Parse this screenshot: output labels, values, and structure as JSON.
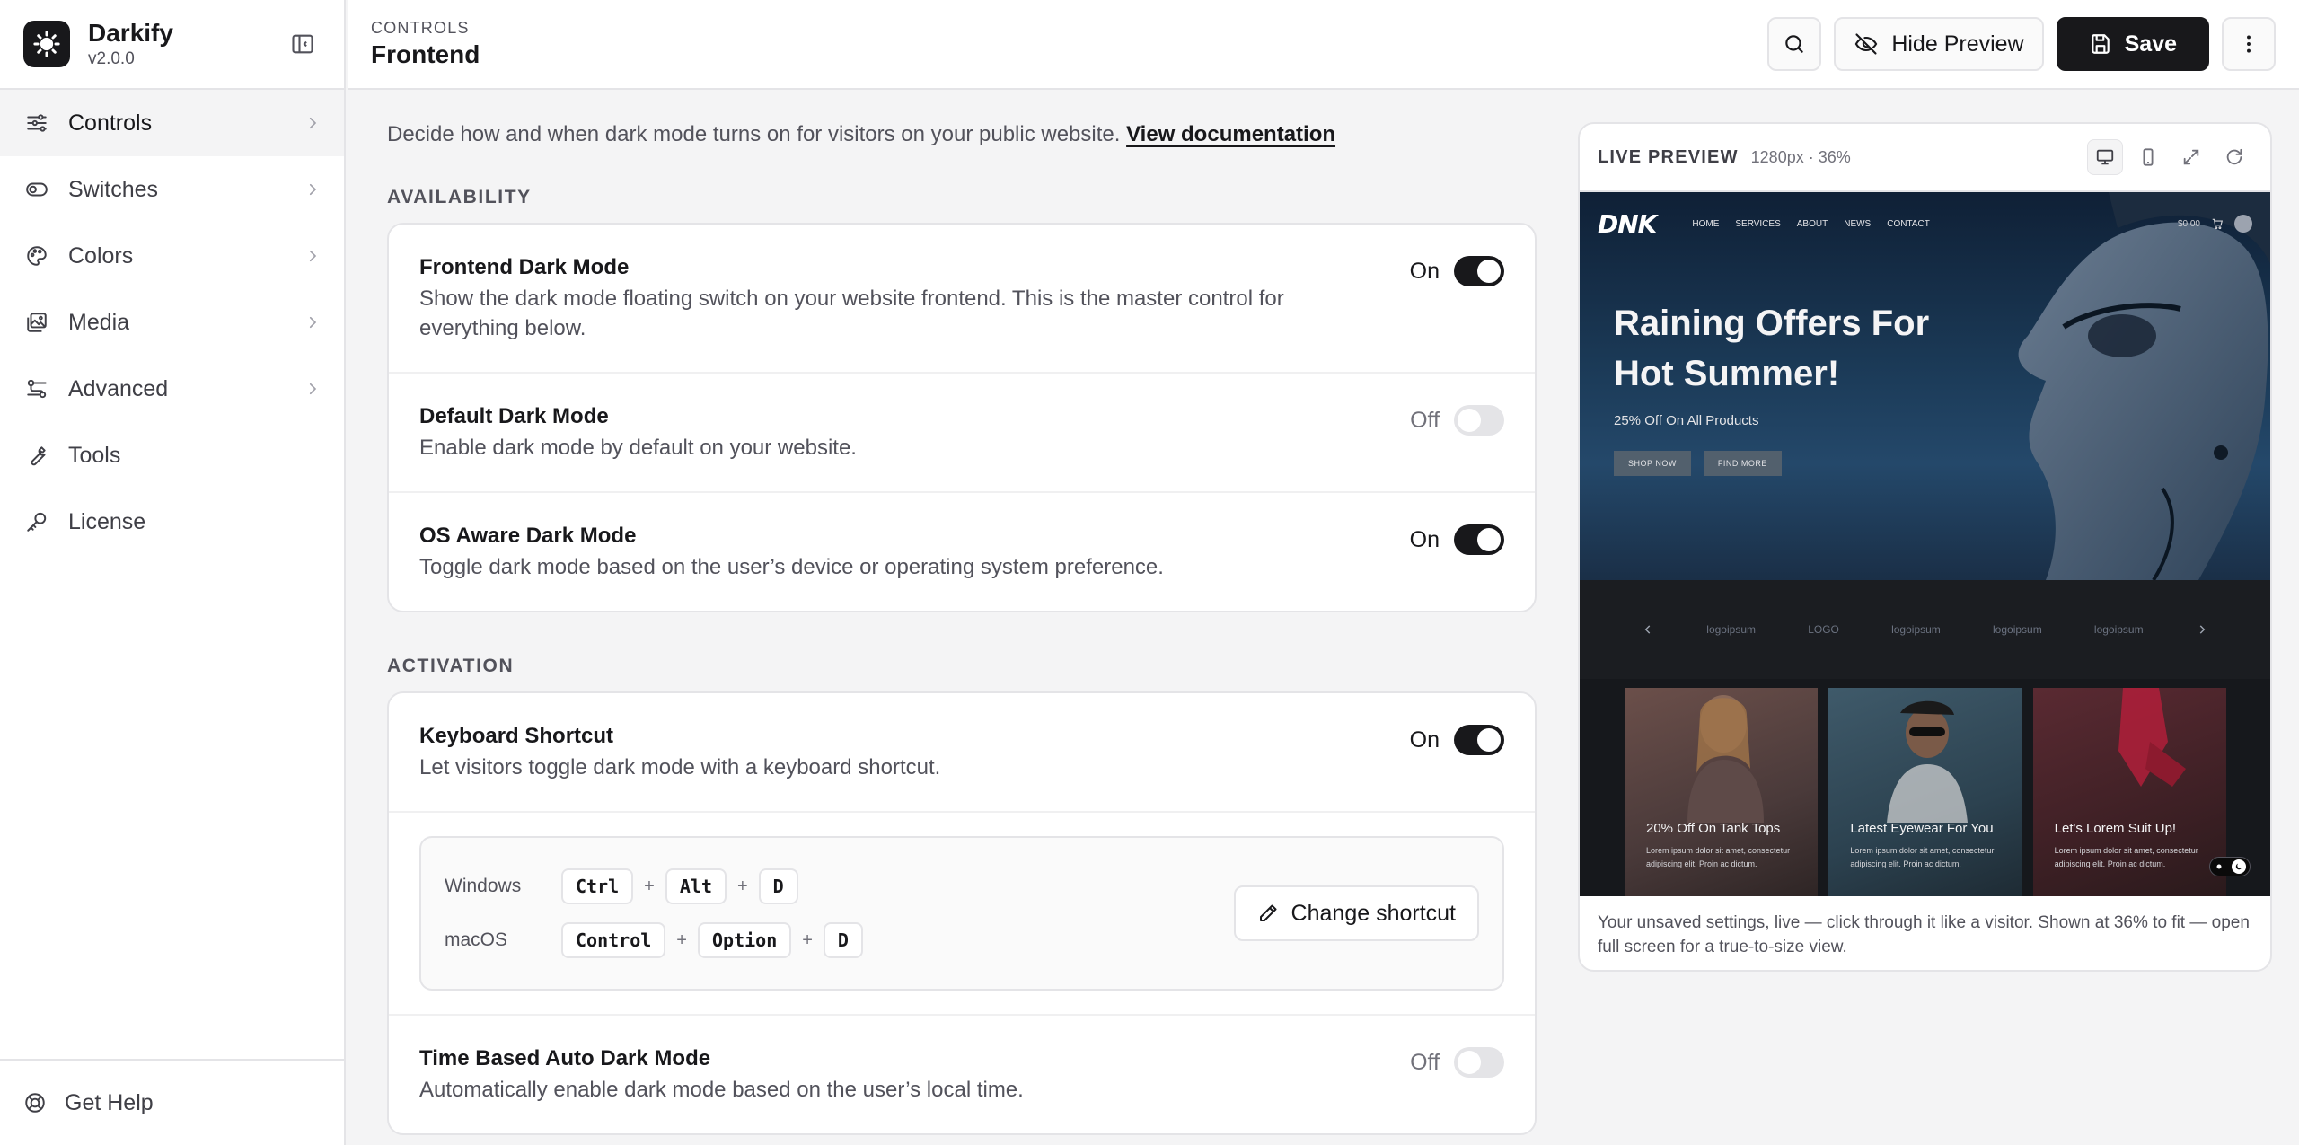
{
  "app": {
    "name": "Darkify",
    "version": "v2.0.0"
  },
  "sidebar": {
    "items": [
      {
        "label": "Controls",
        "icon": "sliders-icon"
      },
      {
        "label": "Switches",
        "icon": "toggle-icon"
      },
      {
        "label": "Colors",
        "icon": "palette-icon"
      },
      {
        "label": "Media",
        "icon": "image-icon"
      },
      {
        "label": "Advanced",
        "icon": "settings-sliders-icon"
      },
      {
        "label": "Tools",
        "icon": "wrench-icon"
      },
      {
        "label": "License",
        "icon": "key-icon"
      }
    ],
    "footer_label": "Get Help"
  },
  "header": {
    "breadcrumb": "CONTROLS",
    "title": "Frontend",
    "hide_preview_label": "Hide Preview",
    "save_label": "Save"
  },
  "intro": {
    "text": "Decide how and when dark mode turns on for visitors on your public website.",
    "link": "View documentation"
  },
  "availability": {
    "label": "AVAILABILITY",
    "rows": [
      {
        "title": "Frontend Dark Mode",
        "desc": "Show the dark mode floating switch on your website frontend. This is the master control for everything below.",
        "state": "On"
      },
      {
        "title": "Default Dark Mode",
        "desc": "Enable dark mode by default on your website.",
        "state": "Off"
      },
      {
        "title": "OS Aware Dark Mode",
        "desc": "Toggle dark mode based on the user’s device or operating system preference.",
        "state": "On"
      }
    ]
  },
  "activation": {
    "label": "ACTIVATION",
    "keyboard": {
      "title": "Keyboard Shortcut",
      "desc": "Let visitors toggle dark mode with a keyboard shortcut.",
      "state": "On"
    },
    "shortcuts": {
      "windows_label": "Windows",
      "windows_keys": [
        "Ctrl",
        "Alt",
        "D"
      ],
      "mac_label": "macOS",
      "mac_keys": [
        "Control",
        "Option",
        "D"
      ],
      "plus": "+",
      "change_label": "Change shortcut"
    },
    "time_based": {
      "title": "Time Based Auto Dark Mode",
      "desc": "Automatically enable dark mode based on the user’s local time.",
      "state": "Off"
    }
  },
  "preview": {
    "title": "LIVE PREVIEW",
    "meta": "1280px · 36%",
    "caption": "Your unsaved settings, live — click through it like a visitor. Shown at 36% to fit — open full screen for a true-to-size view.",
    "site": {
      "logo": "DNK",
      "nav": [
        "HOME",
        "SERVICES",
        "ABOUT",
        "NEWS",
        "CONTACT"
      ],
      "cart": "$0.00",
      "hero_title": "Raining Offers For Hot Summer!",
      "hero_sub": "25% Off On All Products",
      "hero_btn1": "SHOP NOW",
      "hero_btn2": "FIND MORE",
      "logos": [
        "logoipsum",
        "LOGO",
        "logoipsum",
        "logoipsum",
        "logoipsum"
      ],
      "cards": [
        {
          "title": "20% Off On Tank Tops",
          "desc": "Lorem ipsum dolor sit amet, consectetur adipiscing elit. Proin ac dictum."
        },
        {
          "title": "Latest Eyewear For You",
          "desc": "Lorem ipsum dolor sit amet, consectetur adipiscing elit. Proin ac dictum."
        },
        {
          "title": "Let's Lorem Suit Up!",
          "desc": "Lorem ipsum dolor sit amet, consectetur adipiscing elit. Proin ac dictum."
        }
      ]
    }
  }
}
